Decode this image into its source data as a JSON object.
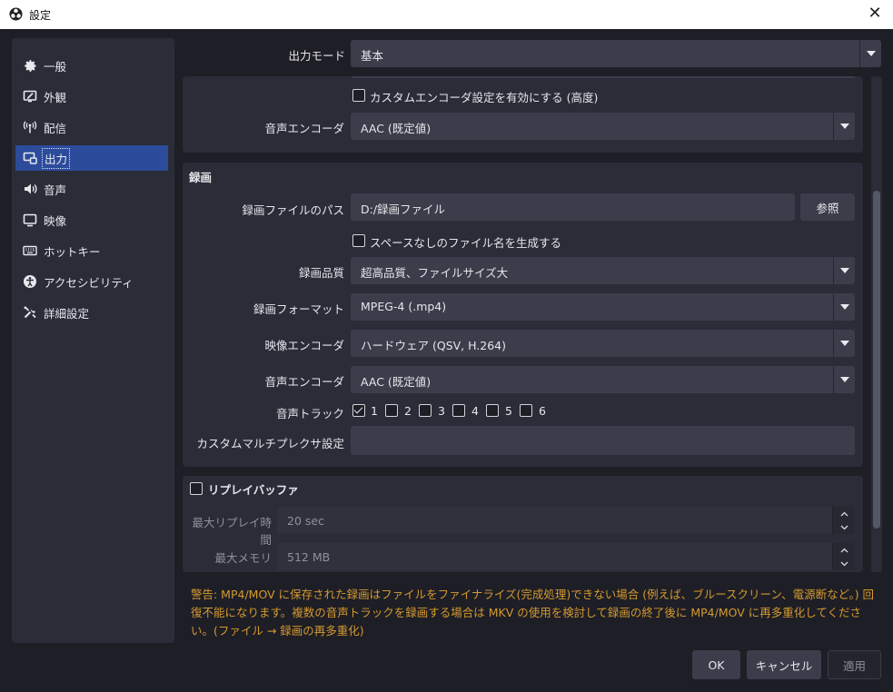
{
  "window": {
    "title": "設定",
    "close_icon": "close-icon"
  },
  "sidebar": {
    "items": [
      {
        "label": "一般",
        "icon": "gear-icon"
      },
      {
        "label": "外観",
        "icon": "appearance-icon"
      },
      {
        "label": "配信",
        "icon": "broadcast-icon"
      },
      {
        "label": "出力",
        "icon": "output-icon",
        "active": true
      },
      {
        "label": "音声",
        "icon": "speaker-icon"
      },
      {
        "label": "映像",
        "icon": "monitor-icon"
      },
      {
        "label": "ホットキー",
        "icon": "keyboard-icon"
      },
      {
        "label": "アクセシビリティ",
        "icon": "accessibility-icon"
      },
      {
        "label": "詳細設定",
        "icon": "tools-icon"
      }
    ]
  },
  "output_mode": {
    "label": "出力モード",
    "value": "基本"
  },
  "streaming": {
    "custom_encoder_label": "カスタムエンコーダ設定を有効にする (高度)",
    "custom_encoder_checked": false,
    "audio_encoder_label": "音声エンコーダ",
    "audio_encoder_value": "AAC (既定値)"
  },
  "recording": {
    "title": "録画",
    "path_label": "録画ファイルのパス",
    "path_value": "D:/録画ファイル",
    "browse_label": "参照",
    "no_space_label": "スペースなしのファイル名を生成する",
    "no_space_checked": false,
    "quality_label": "録画品質",
    "quality_value": "超高品質、ファイルサイズ大",
    "format_label": "録画フォーマット",
    "format_value": "MPEG-4 (.mp4)",
    "video_encoder_label": "映像エンコーダ",
    "video_encoder_value": "ハードウェア (QSV, H.264)",
    "audio_encoder_label": "音声エンコーダ",
    "audio_encoder_value": "AAC (既定値)",
    "audio_track_label": "音声トラック",
    "tracks": [
      {
        "label": "1",
        "checked": true
      },
      {
        "label": "2",
        "checked": false
      },
      {
        "label": "3",
        "checked": false
      },
      {
        "label": "4",
        "checked": false
      },
      {
        "label": "5",
        "checked": false
      },
      {
        "label": "6",
        "checked": false
      }
    ],
    "muxer_label": "カスタムマルチプレクサ設定",
    "muxer_value": ""
  },
  "replay_buffer": {
    "title": "リプレイバッファ",
    "enabled": false,
    "max_time_label": "最大リプレイ時間",
    "max_time_value": "20 sec",
    "max_memory_label": "最大メモリ",
    "max_memory_value": "512 MB"
  },
  "warning": "警告: MP4/MOV に保存された録画はファイルをファイナライズ(完成処理)できない場合 (例えば、ブルースクリーン、電源断など。) 回復不能になります。複数の音声トラックを録画する場合は MKV の使用を検討して録画の終了後に MP4/MOV に再多重化してください。(ファイル → 録画の再多重化)",
  "footer": {
    "ok": "OK",
    "cancel": "キャンセル",
    "apply": "適用"
  },
  "colors": {
    "accent": "#2c4c9b",
    "warning": "#d49a2f",
    "background": "#1e1e26",
    "panel": "#2a2c38"
  }
}
